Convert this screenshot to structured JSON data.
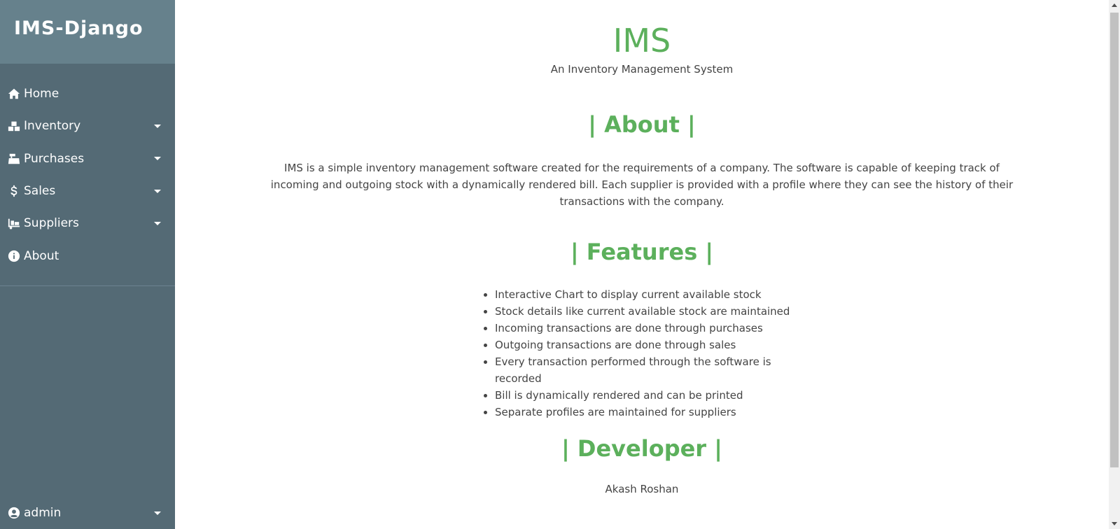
{
  "brand": "IMS-Django",
  "sidebar": {
    "items": [
      {
        "label": "Home",
        "icon": "home-icon"
      },
      {
        "label": "Inventory",
        "icon": "boxes-icon",
        "dropdown": true
      },
      {
        "label": "Purchases",
        "icon": "cash-register-icon",
        "dropdown": true
      },
      {
        "label": "Sales",
        "icon": "dollar-icon",
        "dropdown": true
      },
      {
        "label": "Suppliers",
        "icon": "truck-loading-icon",
        "dropdown": true
      },
      {
        "label": "About",
        "icon": "info-circle-icon"
      }
    ],
    "user": {
      "label": "admin",
      "icon": "user-circle-icon"
    }
  },
  "main": {
    "title": "IMS",
    "subtitle": "An Inventory Management System",
    "about_heading": "| About |",
    "about_text": "IMS is a simple inventory management software created for the requirements of a company. The software is capable of keeping track of incoming and outgoing stock with a dynamically rendered bill. Each supplier is provided with a profile where they can see the history of their transactions with the company.",
    "features_heading": "| Features |",
    "features": [
      "Interactive Chart to display current available stock",
      "Stock details like current available stock are maintained",
      "Incoming transactions are done through purchases",
      "Outgoing transactions are done through sales",
      "Every transaction performed through the software is recorded",
      "Bill is dynamically rendered and can be printed",
      "Separate profiles are maintained for suppliers"
    ],
    "developer_heading": "| Developer |",
    "developer_name": "Akash Roshan"
  },
  "colors": {
    "sidebar_bg": "#546a75",
    "brand_bg": "#66818c",
    "accent_green": "#5cb05c",
    "text": "#444444"
  }
}
